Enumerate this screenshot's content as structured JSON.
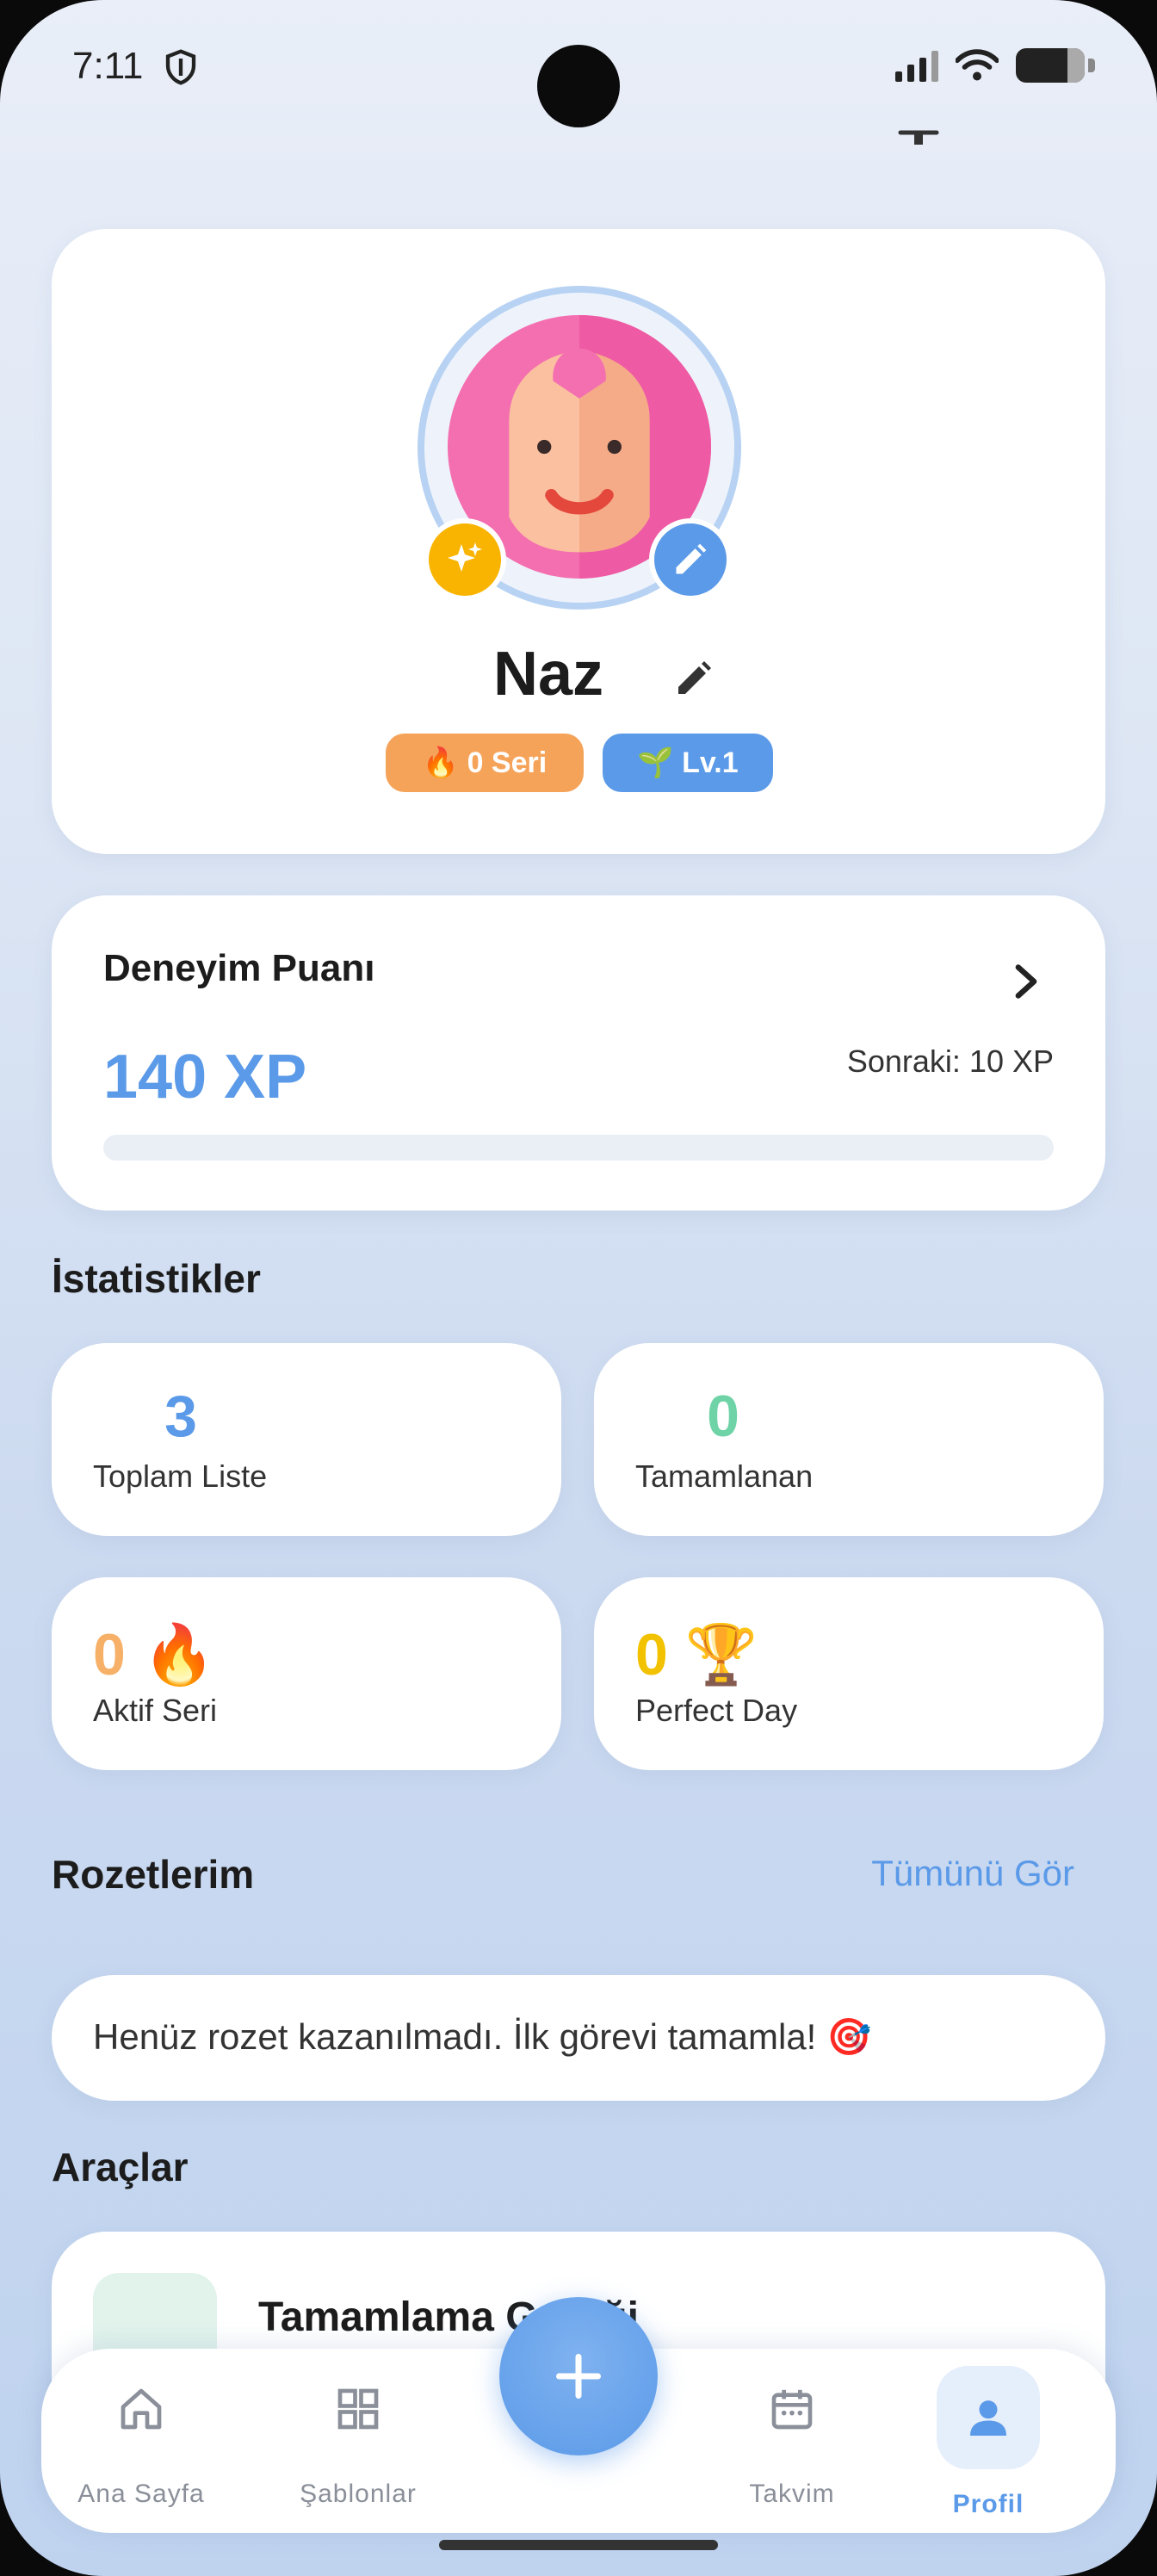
{
  "status_bar": {
    "time": "7:11"
  },
  "profile": {
    "name": "Naz",
    "streak_pill": "🔥 0 Seri",
    "level_pill": "🌱 Lv.1"
  },
  "xp": {
    "title": "Deneyim Puanı",
    "value": "140 XP",
    "next": "Sonraki: 10 XP",
    "progress": 0
  },
  "stats": {
    "title": "İstatistikler",
    "total_lists": {
      "value": "3",
      "label": "Toplam Liste",
      "color": "#5b9ae8"
    },
    "completed": {
      "value": "0",
      "label": "Tamamlanan",
      "color": "#6ed3a6"
    },
    "active_streak": {
      "value": "0",
      "emoji": "🔥",
      "label": "Aktif Seri",
      "color": "#f6b067"
    },
    "perfect_day": {
      "value": "0",
      "emoji": "🏆",
      "label": "Perfect Day",
      "color": "#f2c200"
    }
  },
  "badges": {
    "title": "Rozetlerim",
    "see_all": "Tümünü Gör",
    "empty_text": "Henüz rozet kazanılmadı. İlk görevi tamamla! 🎯"
  },
  "tools": {
    "title": "Araçlar",
    "first_item": "Tamamlama Grafiği"
  },
  "nav": {
    "items": [
      {
        "label": "Ana Sayfa",
        "icon": "home-icon"
      },
      {
        "label": "Şablonlar",
        "icon": "grid-icon"
      },
      {
        "label": "Takvim",
        "icon": "calendar-icon"
      },
      {
        "label": "Profil",
        "icon": "person-icon"
      }
    ],
    "active": "Profil"
  },
  "colors": {
    "accent": "#5b9ae8",
    "streak": "#f6a35a"
  }
}
